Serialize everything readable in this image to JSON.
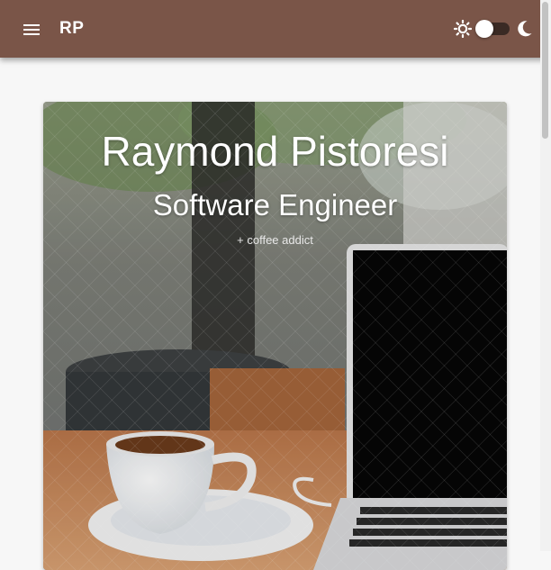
{
  "header": {
    "brand": "RP",
    "menu_icon": "hamburger-menu-icon",
    "theme": {
      "light_icon": "sun-icon",
      "dark_icon": "moon-icon",
      "dark_mode_enabled": false
    }
  },
  "hero": {
    "name": "Raymond Pistoresi",
    "title": "Software Engineer",
    "subtitle": "+ coffee addict",
    "background": "photo of coffee cup and laptop on wooden table"
  },
  "colors": {
    "brand": "#7a5548",
    "page_bg": "#f7f7f7"
  }
}
